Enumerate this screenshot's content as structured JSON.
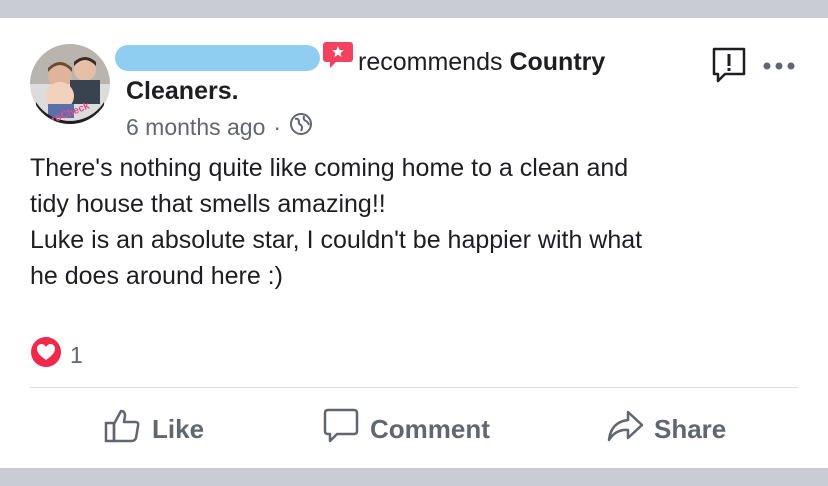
{
  "post": {
    "author_redacted": true,
    "recommends_text": "recommends",
    "page_name_part1": "Country",
    "page_name_part2": "Cleaners.",
    "timestamp": "6 months ago",
    "separator": "·",
    "privacy": "globe-icon",
    "avatar_caption": "#BroCheck",
    "body_lines": [
      "There's nothing quite like coming home to a clean and",
      "tidy house that smells amazing!!",
      "Luke is an absolute star, I couldn't be happier with what",
      "he does around here :)"
    ],
    "reaction_count": "1"
  },
  "actions": {
    "like_label": "Like",
    "comment_label": "Comment",
    "share_label": "Share"
  },
  "colors": {
    "page_bg": "#c9ccd3",
    "card_bg": "#ffffff",
    "text_primary": "#1c1e21",
    "text_secondary": "#606770",
    "recommend_badge": "#f3425f",
    "love_reaction": "#f0284a",
    "redaction": "#8fcdf1"
  }
}
